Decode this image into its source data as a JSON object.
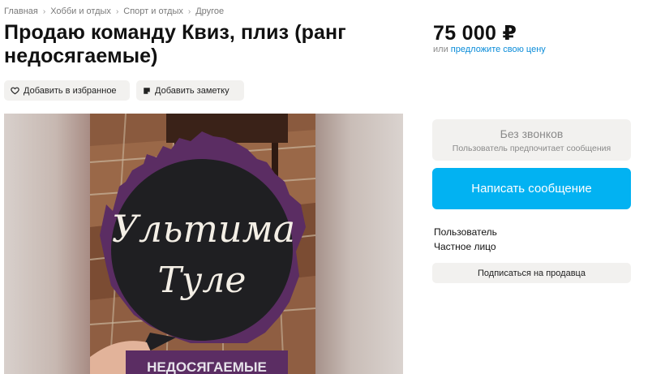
{
  "breadcrumb": [
    "Главная",
    "Хобби и отдых",
    "Спорт и отдых",
    "Другое"
  ],
  "listing": {
    "title": "Продаю команду Квиз, плиз (ранг недосягаемые)",
    "price": "75 000 ₽",
    "price_or": "или",
    "price_offer_link": "предложите свою цену"
  },
  "actions": {
    "favorite_label": "Добавить в избранное",
    "note_label": "Добавить заметку"
  },
  "photo": {
    "sign_line1": "Ультима",
    "sign_line2": "Туле",
    "plaque_text": "НЕДОСЯГАЕМЫЕ"
  },
  "contact": {
    "no_calls_title": "Без звонков",
    "no_calls_subtitle": "Пользователь предпочитает сообщения",
    "message_button": "Написать сообщение"
  },
  "seller": {
    "name": "Пользователь",
    "type": "Частное лицо",
    "subscribe_button": "Подписаться на продавца"
  },
  "colors": {
    "accent_blue": "#02b2f2",
    "link_blue": "#0a8cd9",
    "chip_bg": "#f2f1ef",
    "trophy_purple": "#5b2d63"
  }
}
